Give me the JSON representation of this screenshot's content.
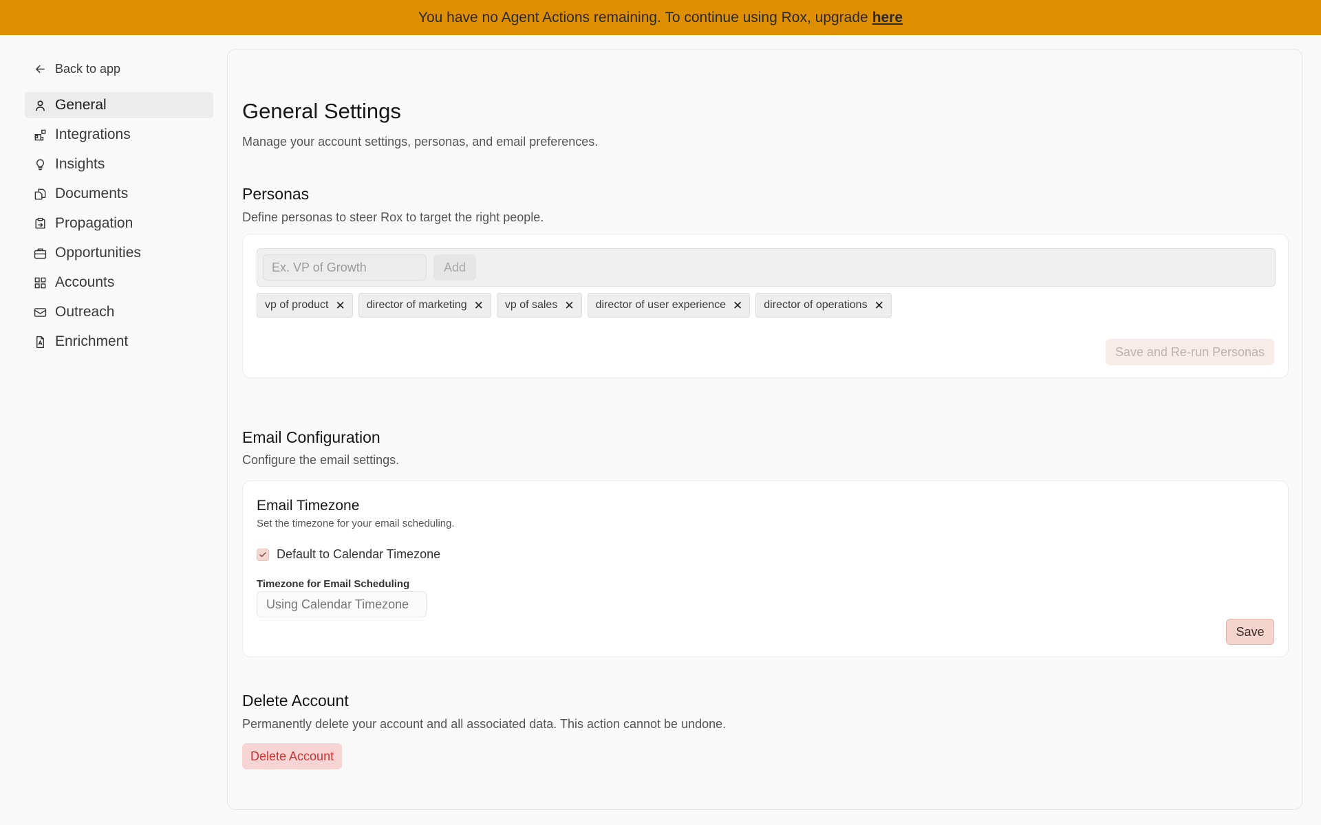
{
  "banner": {
    "text": "You have no Agent Actions remaining. To continue using Rox, upgrade",
    "link_label": "here",
    "color": "#df9002"
  },
  "sidebar": {
    "back_label": "Back to app",
    "items": [
      {
        "label": "General",
        "icon": "user-icon",
        "active": true
      },
      {
        "label": "Integrations",
        "icon": "integrations-icon"
      },
      {
        "label": "Insights",
        "icon": "lightbulb-icon"
      },
      {
        "label": "Documents",
        "icon": "documents-icon"
      },
      {
        "label": "Propagation",
        "icon": "propagation-icon"
      },
      {
        "label": "Opportunities",
        "icon": "briefcase-icon"
      },
      {
        "label": "Accounts",
        "icon": "grid-icon"
      },
      {
        "label": "Outreach",
        "icon": "mail-icon"
      },
      {
        "label": "Enrichment",
        "icon": "file-icon"
      }
    ]
  },
  "main": {
    "title": "General Settings",
    "subtitle": "Manage your account settings, personas, and email preferences.",
    "personas": {
      "heading": "Personas",
      "description": "Define personas to steer Rox to target the right people.",
      "input_placeholder": "Ex. VP of Growth",
      "add_label": "Add",
      "tags": [
        "vp of product",
        "director of marketing",
        "vp of sales",
        "director of user experience",
        "director of operations"
      ],
      "rerun_label": "Save and Re-run Personas"
    },
    "email": {
      "heading": "Email Configuration",
      "description": "Configure the email settings.",
      "card_title": "Email Timezone",
      "card_subtitle": "Set the timezone for your email scheduling.",
      "checkbox_label": "Default to Calendar Timezone",
      "checkbox_checked": true,
      "timezone_label": "Timezone for Email Scheduling",
      "timezone_placeholder": "Using Calendar Timezone",
      "save_label": "Save"
    },
    "delete": {
      "heading": "Delete Account",
      "description": "Permanently delete your account and all associated data. This action cannot be undone.",
      "button_label": "Delete Account",
      "color": "#cc3535"
    }
  }
}
